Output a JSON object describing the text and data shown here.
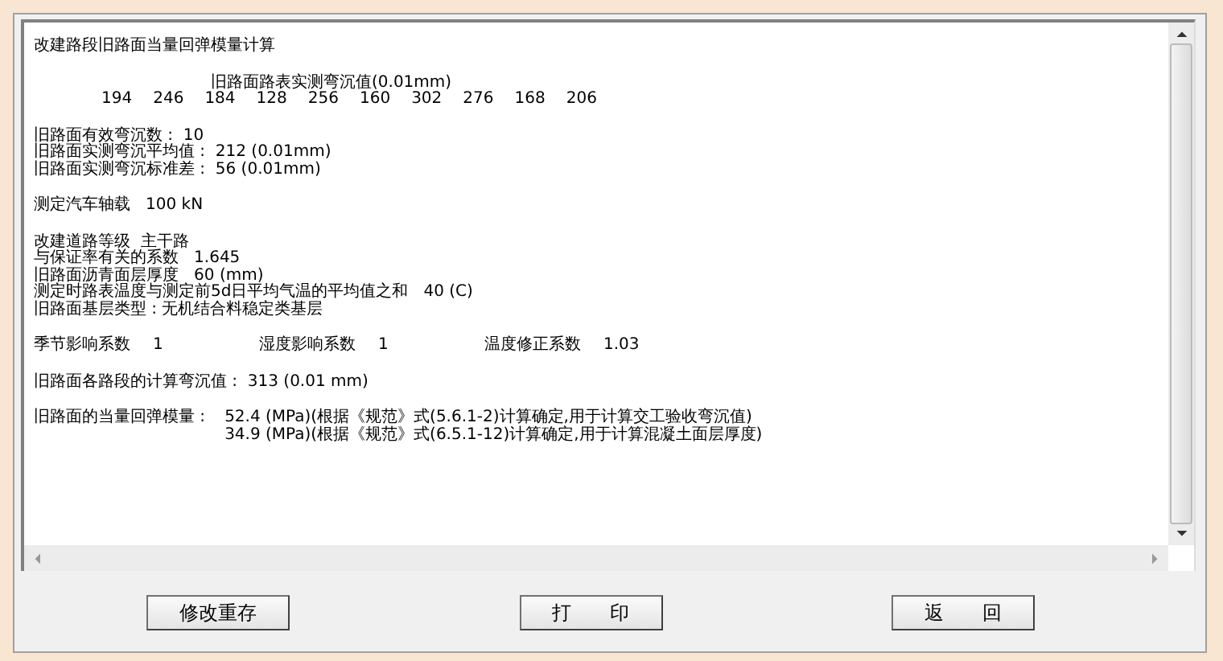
{
  "report": {
    "groups": [
      {
        "kind": "text",
        "lines": [
          "改建路段旧路面当量回弹模量计算"
        ]
      },
      {
        "kind": "values",
        "heading": "旧路面路表实测弯沉值(0.01mm)",
        "values": [
          "194",
          "246",
          "184",
          "128",
          "256",
          "160",
          "302",
          "276",
          "168",
          "206"
        ]
      },
      {
        "kind": "text",
        "lines": [
          "旧路面有效弯沉数 :  10",
          "旧路面实测弯沉平均值 :  212 (0.01mm)",
          "旧路面实测弯沉标准差 :  56 (0.01mm)"
        ]
      },
      {
        "kind": "text",
        "lines": [
          "测定汽车轴载   100 kN"
        ]
      },
      {
        "kind": "text",
        "lines": [
          "改建道路等级  主干路",
          "与保证率有关的系数   1.645",
          "旧路面沥青面层厚度   60 (mm)",
          "测定时路表温度与测定前5d日平均气温的平均值之和   40 (C)",
          "旧路面基层类型 : 无机结合料稳定类基层"
        ]
      },
      {
        "kind": "columns",
        "items": [
          {
            "label": "季节影响系数",
            "value": "1"
          },
          {
            "label": "湿度影响系数",
            "value": "1"
          },
          {
            "label": "温度修正系数",
            "value": "1.03"
          }
        ]
      },
      {
        "kind": "text",
        "lines": [
          "旧路面各路段的计算弯沉值 :  313 (0.01 mm)"
        ]
      },
      {
        "kind": "modulus",
        "label": "旧路面的当量回弹模量 :",
        "lines": [
          "52.4 (MPa)(根据《规范》式(5.6.1-2)计算确定,用于计算交工验收弯沉值)",
          "34.9 (MPa)(根据《规范》式(6.5.1-12)计算确定,用于计算混凝土面层厚度)"
        ]
      }
    ]
  },
  "buttons": [
    "修改重存",
    "打　　印",
    "返　　回"
  ]
}
